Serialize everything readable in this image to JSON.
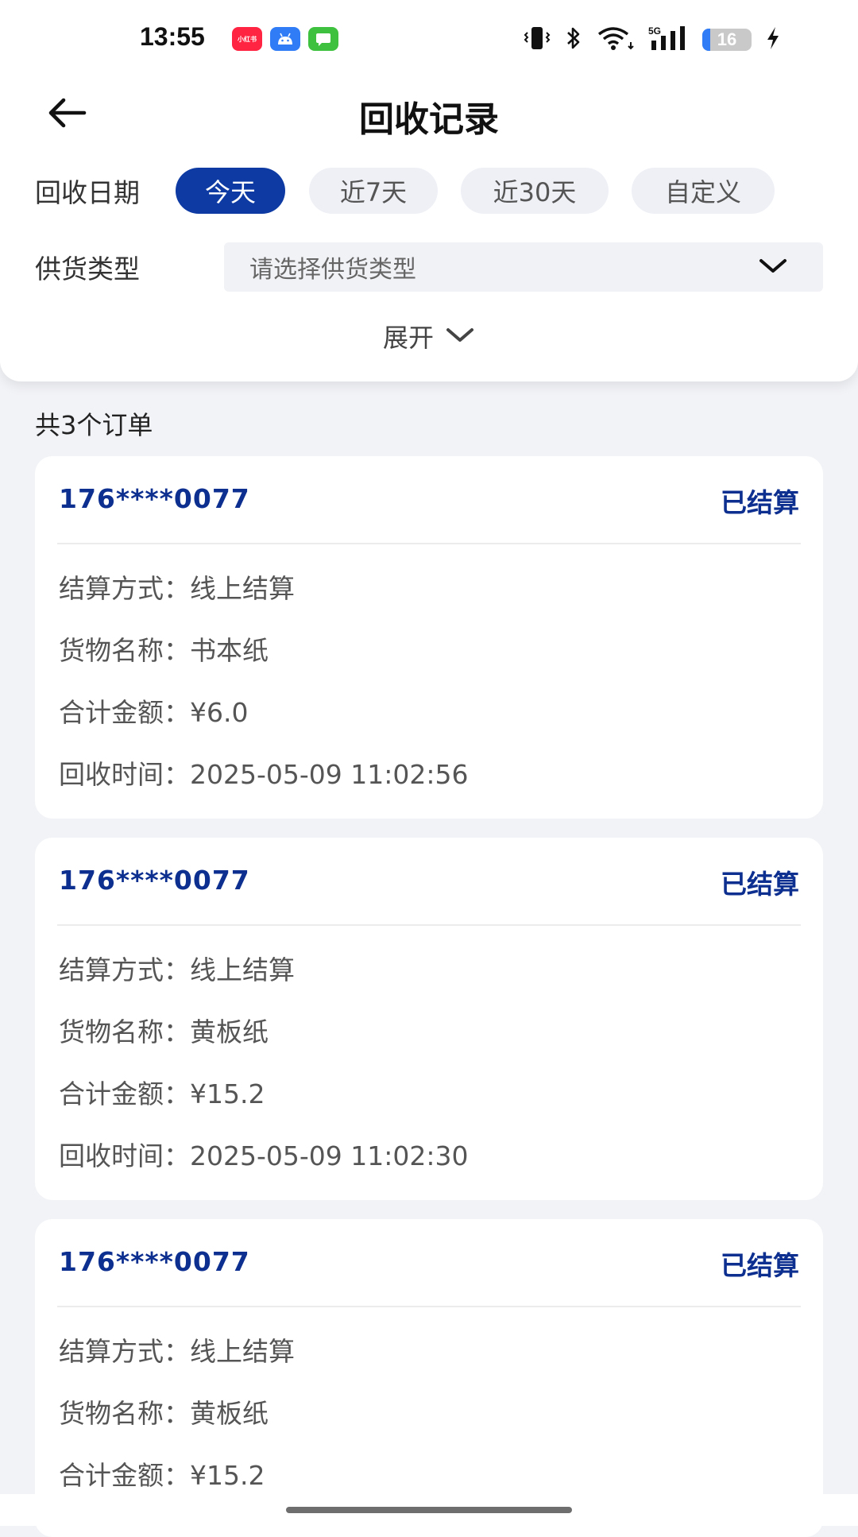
{
  "status_bar": {
    "time": "13:55",
    "app_icons": [
      {
        "name": "xiaohongshu-icon",
        "color": "#ff2442",
        "text": "小红书"
      },
      {
        "name": "android-icon",
        "color": "#2f7cf6",
        "text": ""
      },
      {
        "name": "messages-icon",
        "color": "#3ec13e",
        "text": ""
      }
    ],
    "network": "5G",
    "battery_level": "16"
  },
  "header": {
    "title": "回收记录",
    "back_icon": "arrow-left-icon"
  },
  "filters": {
    "date_label": "回收日期",
    "date_options": [
      "今天",
      "近7天",
      "近30天",
      "自定义"
    ],
    "date_selected": "今天",
    "type_label": "供货类型",
    "type_placeholder": "请选择供货类型",
    "expand_label": "展开"
  },
  "summary": {
    "count_text": "共3个订单"
  },
  "orders": [
    {
      "phone": "176****0077",
      "status": "已结算",
      "settle_method_label": "结算方式：",
      "settle_method": "线上结算",
      "goods_label": "货物名称：",
      "goods": "书本纸",
      "amount_label": "合计金额：",
      "amount": "¥6.0",
      "time_label": "回收时间：",
      "time": "2025-05-09 11:02:56"
    },
    {
      "phone": "176****0077",
      "status": "已结算",
      "settle_method_label": "结算方式：",
      "settle_method": "线上结算",
      "goods_label": "货物名称：",
      "goods": "黄板纸",
      "amount_label": "合计金额：",
      "amount": "¥15.2",
      "time_label": "回收时间：",
      "time": "2025-05-09 11:02:30"
    },
    {
      "phone": "176****0077",
      "status": "已结算",
      "settle_method_label": "结算方式：",
      "settle_method": "线上结算",
      "goods_label": "货物名称：",
      "goods": "黄板纸",
      "amount_label": "合计金额：",
      "amount": "¥15.2"
    }
  ],
  "colors": {
    "accent": "#0d3aa3",
    "accent_text": "#0d2f8f",
    "background": "#f2f3f7"
  }
}
